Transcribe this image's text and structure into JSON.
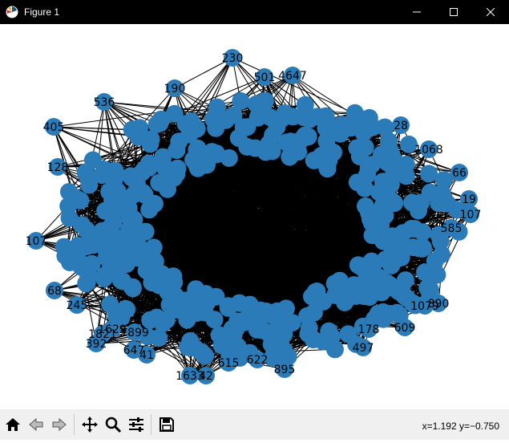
{
  "window": {
    "title": "Figure 1",
    "controls": [
      "minimize",
      "maximize",
      "close"
    ]
  },
  "figure": {
    "type": "network graph",
    "node_color": "#2b7bb9",
    "edge_color": "#000000",
    "outer_nodes": [
      {
        "label": "230"
      },
      {
        "label": "501"
      },
      {
        "label": "4647"
      },
      {
        "label": "536"
      },
      {
        "label": "405"
      },
      {
        "label": "190"
      },
      {
        "label": "128"
      },
      {
        "label": "107"
      },
      {
        "label": "68"
      },
      {
        "label": "245"
      },
      {
        "label": "392"
      },
      {
        "label": "647"
      },
      {
        "label": "41"
      },
      {
        "label": "1633"
      },
      {
        "label": "42"
      },
      {
        "label": "615"
      },
      {
        "label": "622"
      },
      {
        "label": "895"
      },
      {
        "label": "497"
      },
      {
        "label": "609"
      },
      {
        "label": "1079"
      },
      {
        "label": "890"
      },
      {
        "label": "107"
      },
      {
        "label": "19"
      },
      {
        "label": "66"
      },
      {
        "label": "1068"
      },
      {
        "label": "28"
      },
      {
        "label": "585"
      },
      {
        "label": "1821"
      },
      {
        "label": "1899"
      },
      {
        "label": "178"
      },
      {
        "label": "1629"
      }
    ]
  },
  "toolbar": {
    "buttons": [
      {
        "name": "home-icon",
        "tooltip": "Reset original view"
      },
      {
        "name": "back-icon",
        "tooltip": "Back"
      },
      {
        "name": "forward-icon",
        "tooltip": "Forward"
      },
      {
        "name": "pan-icon",
        "tooltip": "Pan"
      },
      {
        "name": "zoom-icon",
        "tooltip": "Zoom"
      },
      {
        "name": "configure-icon",
        "tooltip": "Configure subplots"
      },
      {
        "name": "save-icon",
        "tooltip": "Save"
      }
    ],
    "coordinates": "x=1.192 y=−0.750"
  }
}
